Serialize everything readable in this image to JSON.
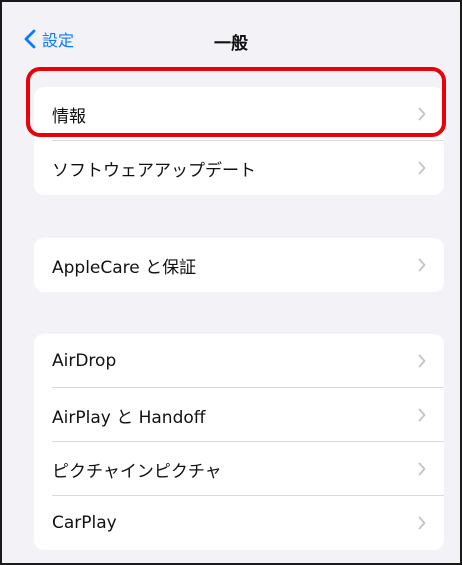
{
  "navbar": {
    "back_label": "設定",
    "title": "一般"
  },
  "groups": [
    {
      "rows": [
        "情報",
        "ソフトウェアアップデート"
      ]
    },
    {
      "rows": [
        "AppleCare と保証"
      ]
    },
    {
      "rows": [
        "AirDrop",
        "AirPlay と Handoff",
        "ピクチャインピクチャ",
        "CarPlay"
      ]
    }
  ],
  "colors": {
    "accent": "#0a7aff",
    "highlight": "#e8000b",
    "background": "#f2f2f7"
  },
  "icons": {
    "back": "chevron-left-icon",
    "row": "chevron-right-icon"
  }
}
